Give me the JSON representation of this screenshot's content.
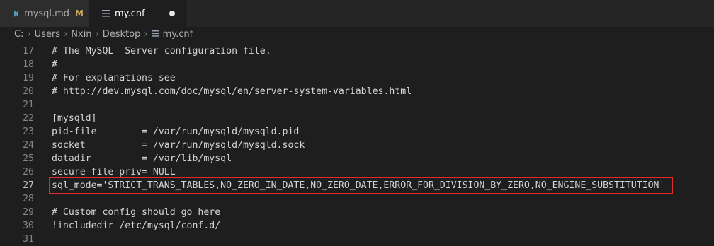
{
  "tabs": [
    {
      "label": "mysql.md",
      "badge": "M"
    },
    {
      "label": "my.cnf"
    }
  ],
  "breadcrumb": [
    "C:",
    "Users",
    "Nxin",
    "Desktop",
    "my.cnf"
  ],
  "editor": {
    "current_line": "27",
    "lines": [
      {
        "num": "17",
        "text": "# The MySQL  Server configuration file."
      },
      {
        "num": "18",
        "text": "#"
      },
      {
        "num": "19",
        "text": "# For explanations see"
      },
      {
        "num": "20",
        "prefix": "# ",
        "link": "http://dev.mysql.com/doc/mysql/en/server-system-variables.html"
      },
      {
        "num": "21",
        "text": ""
      },
      {
        "num": "22",
        "text": "[mysqld]"
      },
      {
        "num": "23",
        "text": "pid-file        = /var/run/mysqld/mysqld.pid"
      },
      {
        "num": "24",
        "text": "socket          = /var/run/mysqld/mysqld.sock"
      },
      {
        "num": "25",
        "text": "datadir         = /var/lib/mysql"
      },
      {
        "num": "26",
        "text": "secure-file-priv= NULL"
      },
      {
        "num": "27",
        "text": "sql_mode='STRICT_TRANS_TABLES,NO_ZERO_IN_DATE,NO_ZERO_DATE,ERROR_FOR_DIVISION_BY_ZERO,NO_ENGINE_SUBSTITUTION'"
      },
      {
        "num": "28",
        "text": ""
      },
      {
        "num": "29",
        "text": "# Custom config should go here"
      },
      {
        "num": "30",
        "text": "!includedir /etc/mysql/conf.d/"
      },
      {
        "num": "31",
        "text": ""
      }
    ]
  },
  "colors": {
    "highlight_box": "#e12b2b",
    "md_icon": "#519aba",
    "modified_badge": "#c9a65a"
  }
}
